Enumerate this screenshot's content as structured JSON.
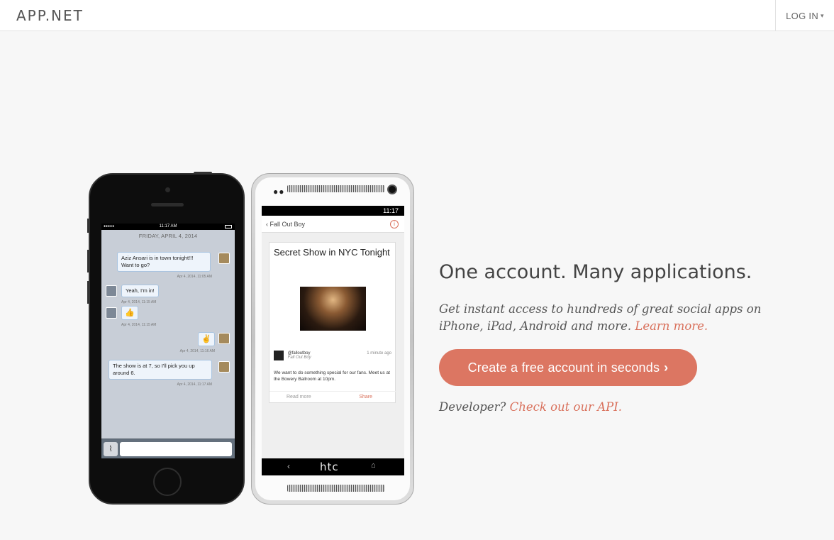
{
  "header": {
    "logo": "APP.NET",
    "login_label": "LOG IN",
    "login_chevron": "⌄"
  },
  "iphone": {
    "time": "11:17 AM",
    "date_divider": "FRIDAY, APRIL 4, 2014",
    "messages": [
      {
        "text": "Aziz Ansari is in town tonight!!! Want to go?",
        "time": "Apr 4, 2014, 11:05 AM"
      },
      {
        "text": "Yeah, I'm in!",
        "time": "Apr 4, 2014, 11:15 AM"
      },
      {
        "text": "👍",
        "time": "Apr 4, 2014, 11:15 AM"
      },
      {
        "text": "✌",
        "time": "Apr 4, 2014, 11:16 AM"
      },
      {
        "text": "The show is at 7, so I'll pick you up around 6.",
        "time": "Apr 4, 2014, 11:17 AM"
      }
    ],
    "attach_icon": "paperclip-icon"
  },
  "htc": {
    "time": "11:17",
    "nav_title": "Fall Out Boy",
    "card_title": "Secret Show in NYC Tonight",
    "handle": "@falloutboy",
    "name": "Fall Out Boy",
    "time_ago": "1 minute ago",
    "body": "We want to do something special for our fans. Meet us at the Bowery Ballroom at 10pm.",
    "read_more": "Read more",
    "share": "Share",
    "brand": "htc"
  },
  "hero": {
    "headline": "One account. Many applications.",
    "lede": "Get instant access to hundreds of great social apps on iPhone, iPad, Android and more.",
    "learn_more": "Learn more.",
    "cta_label": "Create a free account in seconds",
    "developer_prefix": "Developer?",
    "api_link": "Check out our API."
  },
  "colors": {
    "accent": "#dc7662",
    "background": "#f7f7f7"
  }
}
